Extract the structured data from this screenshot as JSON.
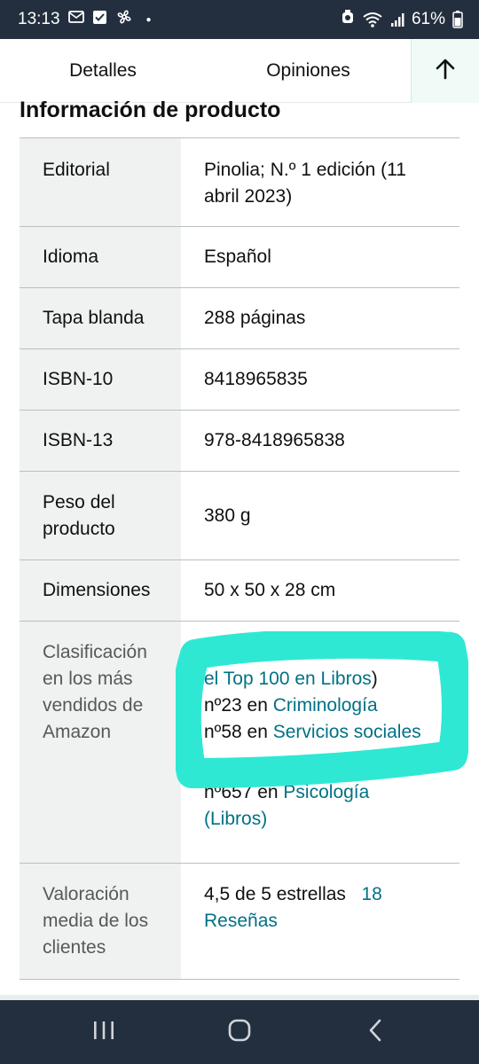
{
  "status_bar": {
    "time": "13:13",
    "battery": "61%",
    "icons": [
      "message-icon",
      "check-icon",
      "pinwheel-icon",
      "notification-dot-icon",
      "alarm-icon",
      "wifi-icon",
      "signal-icon",
      "battery-icon"
    ]
  },
  "tabs": {
    "details": "Detalles",
    "reviews": "Opiniones",
    "back_to_top_icon": "arrow-up-icon"
  },
  "section": {
    "title": "Información de producto"
  },
  "product_info": {
    "editorial": {
      "label": "Editorial",
      "value": "Pinolia; N.º 1 edición (11 abril 2023)"
    },
    "idioma": {
      "label": "Idioma",
      "value": "Español"
    },
    "tapa": {
      "label": "Tapa blanda",
      "value": "288 páginas"
    },
    "isbn10": {
      "label": "ISBN-10",
      "value": "8418965835"
    },
    "isbn13": {
      "label": "ISBN-13",
      "value": "978-8418965838"
    },
    "peso": {
      "label": "Peso del producto",
      "value": "380 g"
    },
    "dimensiones": {
      "label": "Dimensiones",
      "value": "50 x 50 x 28 cm"
    },
    "ranking": {
      "label": "Clasificación en los más vendidos de Amazon",
      "top_link": "el Top 100 en Libros",
      "top_suffix": ")",
      "item1_prefix": "nº23 en ",
      "item1_link": "Criminología",
      "item2_prefix": "nº58 en ",
      "item2_link": "Servicios sociales",
      "item3_prefix": "nº657 en ",
      "item3_link": "Psicología (Libros)"
    },
    "rating": {
      "label": "Valoración media de los clientes",
      "stars_text": "4,5 de 5 estrellas",
      "reviews_link": "18 Reseñas"
    }
  },
  "annotation": {
    "color": "#2ee8d4"
  },
  "nav_bar": {
    "recents_icon": "recent-apps-icon",
    "home_icon": "home-icon",
    "back_icon": "back-icon"
  }
}
